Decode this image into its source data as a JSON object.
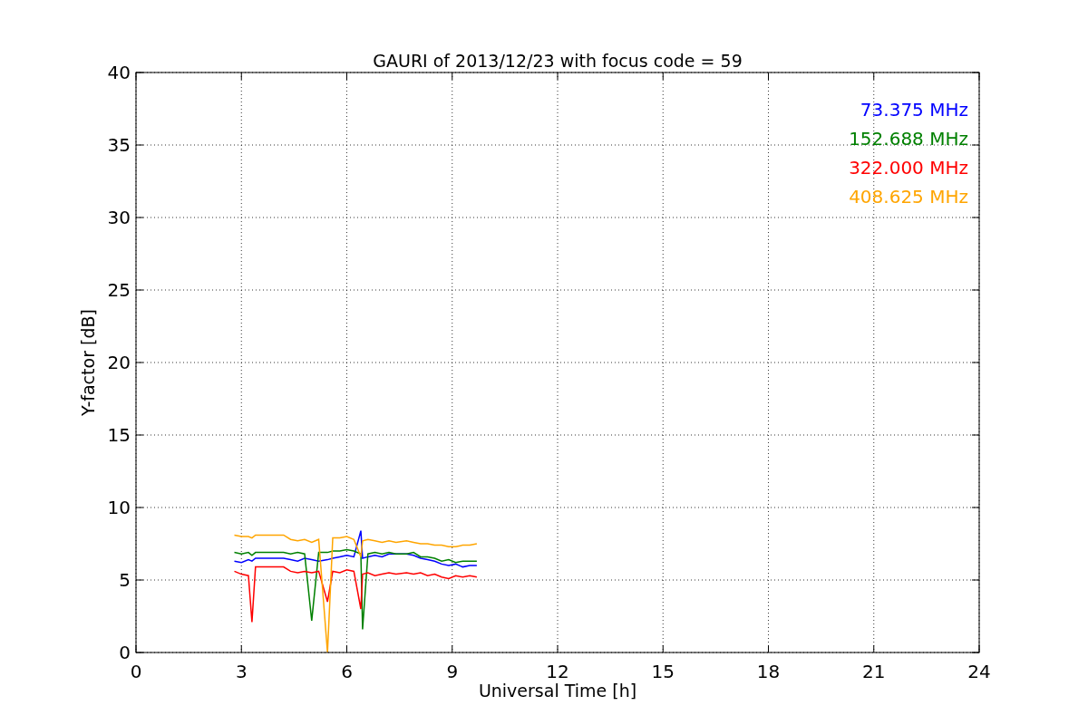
{
  "chart_data": {
    "type": "line",
    "title": "GAURI of 2013/12/23 with focus code = 59",
    "xlabel": "Universal Time [h]",
    "ylabel": "Y-factor [dB]",
    "x": [
      2.8,
      3.0,
      3.2,
      3.3,
      3.4,
      4.2,
      4.4,
      4.6,
      4.8,
      5.0,
      5.2,
      5.45,
      5.6,
      5.8,
      6.0,
      6.2,
      6.4,
      6.45,
      6.6,
      6.8,
      7.0,
      7.2,
      7.4,
      7.7,
      7.9,
      8.1,
      8.3,
      8.5,
      8.7,
      8.9,
      9.1,
      9.3,
      9.5,
      9.7
    ],
    "series": [
      {
        "name": "73.375 MHz",
        "color": "#0000ff",
        "values": [
          6.3,
          6.2,
          6.4,
          6.3,
          6.5,
          6.5,
          6.4,
          6.3,
          6.5,
          6.4,
          6.3,
          6.4,
          6.5,
          6.6,
          6.7,
          6.6,
          8.4,
          6.5,
          6.6,
          6.7,
          6.6,
          6.8,
          6.8,
          6.8,
          6.7,
          6.5,
          6.4,
          6.3,
          6.1,
          6.0,
          6.1,
          5.9,
          6.0,
          6.0
        ]
      },
      {
        "name": "152.688 MHz",
        "color": "#008000",
        "values": [
          6.9,
          6.8,
          6.9,
          6.7,
          6.9,
          6.9,
          6.8,
          6.9,
          6.8,
          2.2,
          6.9,
          6.9,
          7.0,
          7.0,
          7.1,
          7.0,
          6.8,
          1.6,
          6.8,
          6.9,
          6.8,
          6.9,
          6.8,
          6.8,
          6.9,
          6.6,
          6.6,
          6.5,
          6.3,
          6.4,
          6.2,
          6.3,
          6.3,
          6.3
        ]
      },
      {
        "name": "322.000 MHz",
        "color": "#ff0000",
        "values": [
          5.6,
          5.4,
          5.3,
          2.1,
          5.9,
          5.9,
          5.6,
          5.5,
          5.6,
          5.5,
          5.6,
          3.5,
          5.6,
          5.5,
          5.7,
          5.6,
          3.0,
          5.4,
          5.5,
          5.3,
          5.4,
          5.5,
          5.4,
          5.5,
          5.4,
          5.5,
          5.3,
          5.4,
          5.2,
          5.1,
          5.3,
          5.2,
          5.3,
          5.2
        ]
      },
      {
        "name": "408.625 MHz",
        "color": "#ffa500",
        "values": [
          8.1,
          8.0,
          8.0,
          7.9,
          8.1,
          8.1,
          7.8,
          7.7,
          7.8,
          7.6,
          7.8,
          0.0,
          7.9,
          7.9,
          8.0,
          7.8,
          6.6,
          7.7,
          7.8,
          7.7,
          7.6,
          7.7,
          7.6,
          7.7,
          7.6,
          7.5,
          7.5,
          7.4,
          7.4,
          7.3,
          7.3,
          7.4,
          7.4,
          7.5
        ]
      }
    ],
    "grid": true,
    "xlim": [
      0,
      24
    ],
    "ylim": [
      0,
      40
    ],
    "xticks": [
      0,
      3,
      6,
      9,
      12,
      15,
      18,
      21,
      24
    ],
    "yticks": [
      0,
      5,
      10,
      15,
      20,
      25,
      30,
      35,
      40
    ]
  }
}
